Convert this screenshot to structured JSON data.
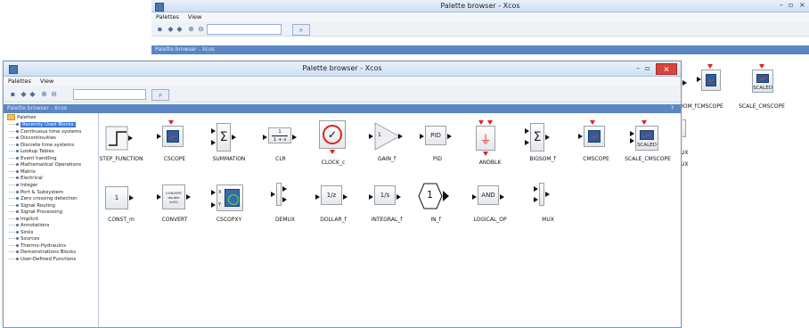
{
  "back_window": {
    "title": "Palette browser - Xcos",
    "menu": [
      "Palettes",
      "View"
    ],
    "path": "Palette browser - Xcos",
    "controls": {
      "minimize": "–",
      "maximize": "▫",
      "close": "×"
    },
    "visible_blocks": [
      "CMSCOPE",
      "SCALE_CMSCOPE",
      "SCALED"
    ],
    "partial_labels": [
      "OOM_f",
      "UX",
      "UX"
    ]
  },
  "front_window": {
    "title": "Palette browser - Xcos",
    "menu": [
      "Palettes",
      "View"
    ],
    "path": "Palette browser - Xcos",
    "controls": {
      "minimize": "–",
      "maximize": "▫",
      "close": "×"
    },
    "help": "?",
    "search_value": "",
    "tree": {
      "root": "Palettes",
      "items": [
        "Recently Used Blocks",
        "Continuous time systems",
        "Discontinuities",
        "Discrete time systems",
        "Lookup Tables",
        "Event handling",
        "Mathematical Operations",
        "Matrix",
        "Electrical",
        "Integer",
        "Port & Subsystem",
        "Zero crossing detection",
        "Signal Routing",
        "Signal Processing",
        "Implicit",
        "Annotations",
        "Sinks",
        "Sources",
        "Thermo-Hydraulics",
        "Demonstrations Blocks",
        "User-Defined Functions"
      ],
      "selected_index": 0
    },
    "blocks_row1": [
      {
        "label": "STEP_FUNCTION",
        "icon": "step-icon"
      },
      {
        "label": "CSCOPE",
        "icon": "scope-icon"
      },
      {
        "label": "SUMMATION",
        "icon": "sigma-icon",
        "glyph": "Σ"
      },
      {
        "label": "CLR",
        "icon": "transfer-fn-icon",
        "num": "1",
        "den": "1 + s"
      },
      {
        "label": "CLOCK_c",
        "icon": "clock-icon"
      },
      {
        "label": "GAIN_f",
        "icon": "gain-icon",
        "glyph": "1"
      },
      {
        "label": "PID",
        "icon": "pid-icon",
        "glyph": "PID"
      },
      {
        "label": "ANDBLK",
        "icon": "and-event-icon"
      },
      {
        "label": "BIGSOM_f",
        "icon": "sigma-icon",
        "glyph": "Σ"
      },
      {
        "label": "CMSCOPE",
        "icon": "scope-icon"
      },
      {
        "label": "SCALE_CMSCOPE",
        "icon": "scaled-scope-icon",
        "glyph": "SCALED"
      }
    ],
    "blocks_row2": [
      {
        "label": "CONST_m",
        "icon": "const-icon",
        "glyph": "1"
      },
      {
        "label": "CONVERT",
        "icon": "convert-icon",
        "glyph": "CONVERT"
      },
      {
        "label": "CSCOPXY",
        "icon": "xy-scope-icon"
      },
      {
        "label": "DEMUX",
        "icon": "demux-icon"
      },
      {
        "label": "DOLLAR_f",
        "icon": "dollar-icon",
        "glyph": "1/z"
      },
      {
        "label": "INTEGRAL_f",
        "icon": "integral-icon",
        "glyph": "1/s"
      },
      {
        "label": "IN_f",
        "icon": "input-port-icon",
        "glyph": "1"
      },
      {
        "label": "LOGICAL_OP",
        "icon": "logic-icon",
        "glyph": "AND"
      },
      {
        "label": "MUX",
        "icon": "mux-icon"
      }
    ],
    "convert_sub": [
      "double",
      "int32"
    ],
    "xy_ports": [
      "X",
      "Y"
    ]
  }
}
